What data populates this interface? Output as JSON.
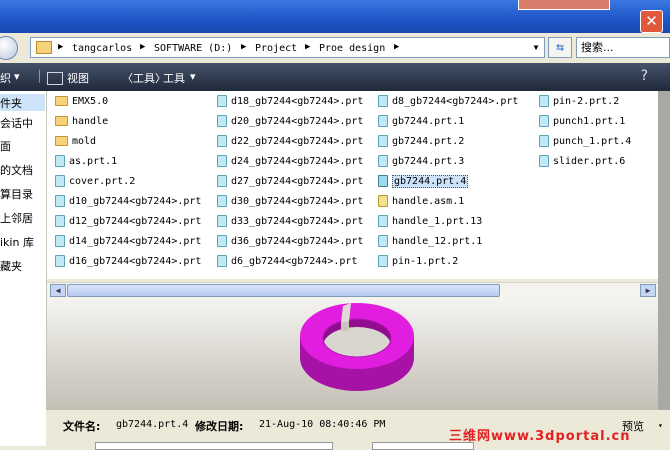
{
  "address": {
    "crumbs": [
      "tangcarlos",
      "SOFTWARE (D:)",
      "Project",
      "Proe design"
    ],
    "search_placeholder": "搜索..."
  },
  "toolbar": {
    "organize": "织",
    "views": "视图",
    "tools_hint": "〈工具〉",
    "tools": "工具"
  },
  "nav": {
    "items": [
      "件夹",
      "会话中",
      "面",
      "的文档",
      "算目录",
      "上邻居",
      "ikin 库",
      "藏夹"
    ]
  },
  "files": {
    "col1": [
      {
        "name": "EMX5.0",
        "type": "folder"
      },
      {
        "name": "handle",
        "type": "folder"
      },
      {
        "name": "mold",
        "type": "folder"
      },
      {
        "name": "as.prt.1",
        "type": "part"
      },
      {
        "name": "cover.prt.2",
        "type": "part"
      },
      {
        "name": "d10_gb7244<gb7244>.prt",
        "type": "part"
      },
      {
        "name": "d12_gb7244<gb7244>.prt",
        "type": "part"
      },
      {
        "name": "d14_gb7244<gb7244>.prt",
        "type": "part"
      },
      {
        "name": "d16_gb7244<gb7244>.prt",
        "type": "part"
      }
    ],
    "col2": [
      {
        "name": "d18_gb7244<gb7244>.prt",
        "type": "part"
      },
      {
        "name": "d20_gb7244<gb7244>.prt",
        "type": "part"
      },
      {
        "name": "d22_gb7244<gb7244>.prt",
        "type": "part"
      },
      {
        "name": "d24_gb7244<gb7244>.prt",
        "type": "part"
      },
      {
        "name": "d27_gb7244<gb7244>.prt",
        "type": "part"
      },
      {
        "name": "d30_gb7244<gb7244>.prt",
        "type": "part"
      },
      {
        "name": "d33_gb7244<gb7244>.prt",
        "type": "part"
      },
      {
        "name": "d36_gb7244<gb7244>.prt",
        "type": "part"
      },
      {
        "name": "d6_gb7244<gb7244>.prt",
        "type": "part"
      }
    ],
    "col3": [
      {
        "name": "d8_gb7244<gb7244>.prt",
        "type": "part"
      },
      {
        "name": "gb7244.prt.1",
        "type": "part"
      },
      {
        "name": "gb7244.prt.2",
        "type": "part"
      },
      {
        "name": "gb7244.prt.3",
        "type": "part"
      },
      {
        "name": "gb7244.prt.4",
        "type": "part",
        "selected": true
      },
      {
        "name": "handle.asm.1",
        "type": "assembly"
      },
      {
        "name": "handle_1.prt.13",
        "type": "part"
      },
      {
        "name": "handle_12.prt.1",
        "type": "part"
      },
      {
        "name": "pin-1.prt.2",
        "type": "part"
      }
    ],
    "col4": [
      {
        "name": "pin-2.prt.2",
        "type": "part"
      },
      {
        "name": "punch1.prt.1",
        "type": "part"
      },
      {
        "name": "punch_1.prt.4",
        "type": "part"
      },
      {
        "name": "slider.prt.6",
        "type": "part"
      }
    ]
  },
  "details": {
    "filename_label": "文件名:",
    "filename_value": "gb7244.prt.4",
    "modified_label": "修改日期:",
    "modified_value": "21-Aug-10 08:40:46 PM",
    "preview_label": "预览"
  },
  "watermark": "三维网www.3dportal.cn",
  "colors": {
    "preview_model": "#e11ee0",
    "selection": "#cde3fa",
    "titlebar": "#1f55c8"
  }
}
